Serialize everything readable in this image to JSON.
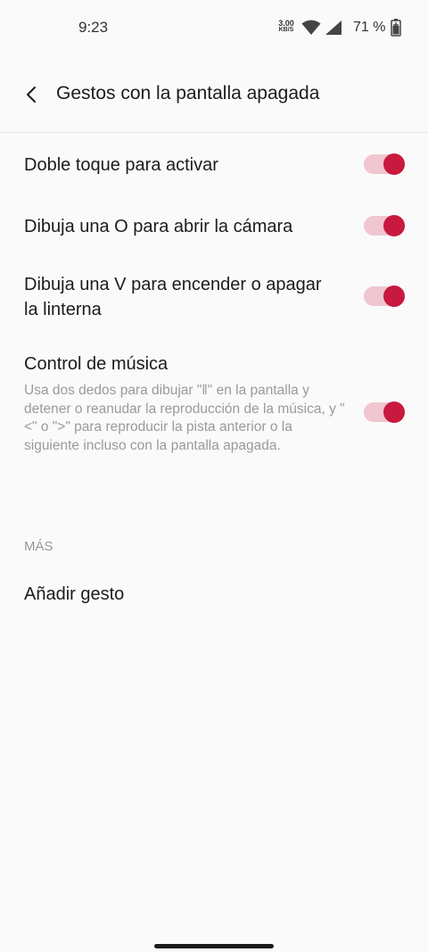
{
  "status_bar": {
    "time": "9:23",
    "net_speed_value": "3.00",
    "net_speed_unit": "KB/S",
    "battery_percent": "71 %"
  },
  "header": {
    "title": "Gestos con la pantalla apagada"
  },
  "settings": [
    {
      "label": "Doble toque para activar",
      "enabled": true
    },
    {
      "label": "Dibuja una O para abrir la cámara",
      "enabled": true
    },
    {
      "label_line1": "Dibuja una V para encender o apagar",
      "label_line2": "la linterna",
      "enabled": true
    },
    {
      "label": "Control de música",
      "description": "Usa dos dedos para dibujar \"‖\" en la pantalla y detener o reanudar la reproducción de la música, y \"<\" o \">\" para reproducir la pista anterior o la siguiente incluso con la pantalla apagada.",
      "enabled": true
    }
  ],
  "more_section": {
    "header": "MÁS",
    "add_gesture_label": "Añadir gesto"
  },
  "colors": {
    "accent": "#c8193f",
    "track": "#f0c6d0",
    "background": "#fafafa"
  }
}
